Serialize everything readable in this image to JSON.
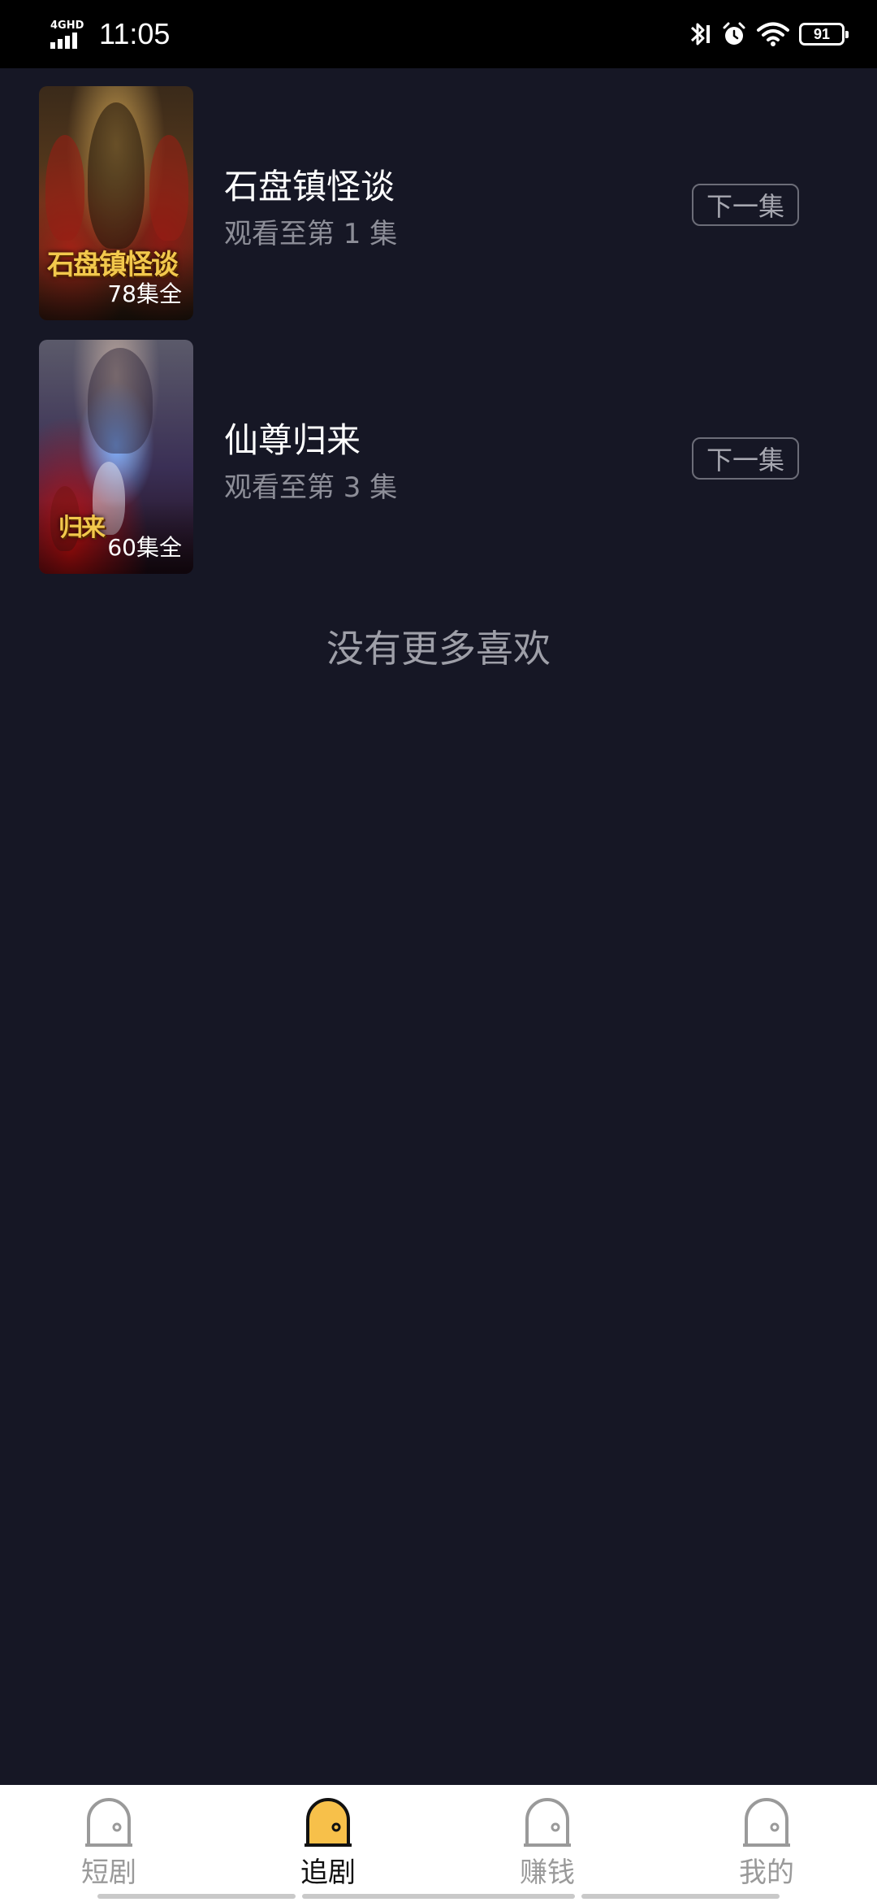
{
  "status_bar": {
    "network": "4GHD",
    "time": "11:05",
    "battery": "91"
  },
  "shows": [
    {
      "poster_title": "石盘镇怪谈",
      "episode_count": "78集全",
      "title": "石盘镇怪谈",
      "progress": "观看至第 1 集",
      "next_label": "下一集"
    },
    {
      "poster_title": "归来",
      "episode_count": "60集全",
      "title": "仙尊归来",
      "progress": "观看至第 3 集",
      "next_label": "下一集"
    }
  ],
  "end_note": "没有更多喜欢",
  "bottom_nav": {
    "active_index": 1,
    "accent_color": "#f7c04a",
    "items": [
      {
        "label": "短剧",
        "icon": "door-icon"
      },
      {
        "label": "追剧",
        "icon": "door-icon"
      },
      {
        "label": "赚钱",
        "icon": "door-icon"
      },
      {
        "label": "我的",
        "icon": "door-icon"
      }
    ]
  }
}
